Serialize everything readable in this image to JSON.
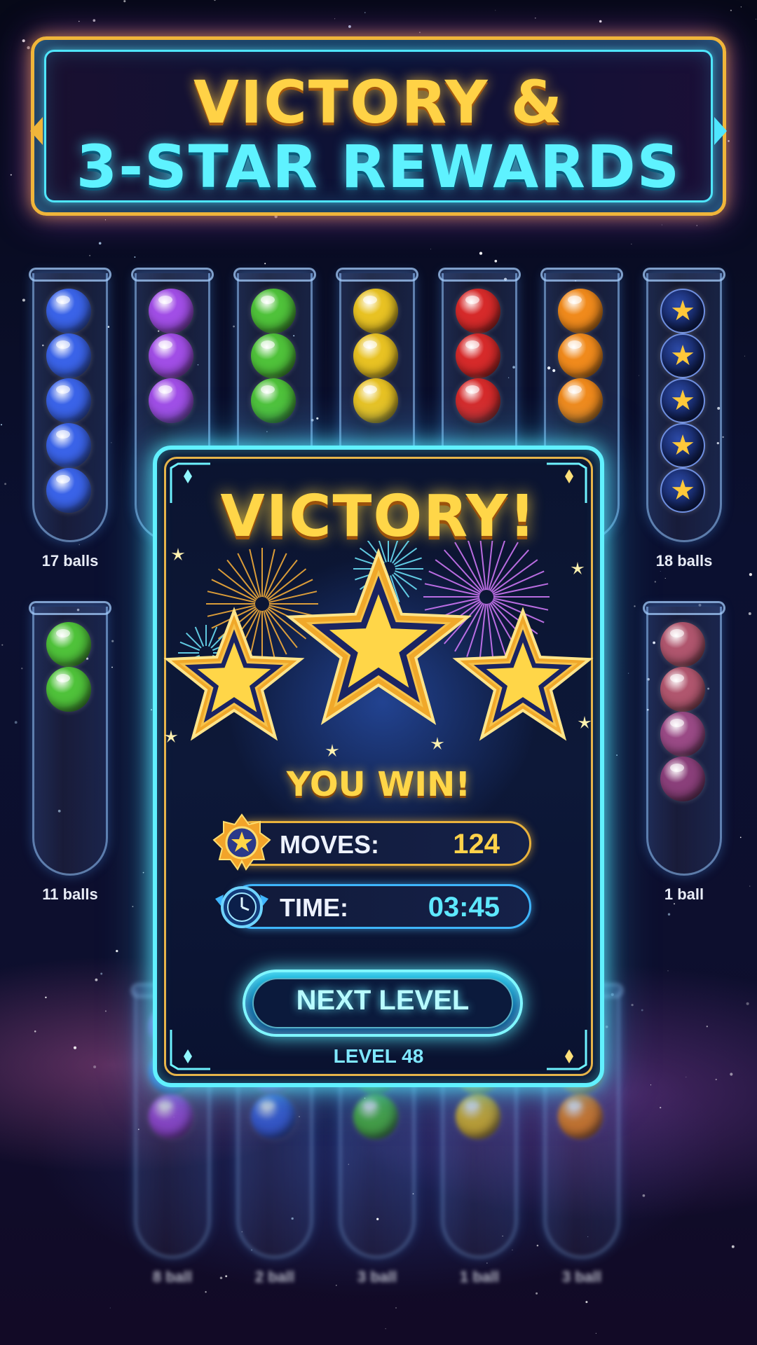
{
  "banner": {
    "line1": "VICTORY &",
    "line2": "3-STAR REWARDS"
  },
  "top_tubes": [
    {
      "label": "17 balls",
      "balls": [
        "#3a63e8",
        "#3a63e8",
        "#3a63e8",
        "#3a63e8",
        "#3a63e8"
      ]
    },
    {
      "label": "",
      "balls": [
        "#a14ee6",
        "#a14ee6",
        "#a14ee6"
      ]
    },
    {
      "label": "",
      "balls": [
        "#4fc23a",
        "#4fc23a",
        "#4fc23a"
      ]
    },
    {
      "label": "",
      "balls": [
        "#e8c223",
        "#e8c223",
        "#e8c223"
      ]
    },
    {
      "label": "",
      "balls": [
        "#d62a2a",
        "#d62a2a",
        "#d62a2a"
      ]
    },
    {
      "label": "",
      "balls": [
        "#f08a1c",
        "#f08a1c",
        "#f08a1c"
      ]
    },
    {
      "label": "18 balls",
      "balls": [
        "star",
        "star",
        "star",
        "star",
        "star"
      ]
    }
  ],
  "mid_tubes": [
    {
      "label": "11 balls",
      "balls": [
        "#4fc23a",
        "#4fc23a"
      ]
    },
    {
      "label": "1 ball",
      "balls": [
        "#b0566e",
        "#b0566e",
        "#9a4a86",
        "#8a3f7a"
      ]
    }
  ],
  "bottom_tubes": [
    {
      "label": "8 ball",
      "balls": [
        "#a14ee6",
        "#3a63e8",
        "#a14ee6"
      ]
    },
    {
      "label": "2 ball",
      "balls": [
        "#3a63e8",
        "#a14ee6",
        "#3a63e8"
      ]
    },
    {
      "label": "3 ball",
      "balls": [
        "#4fc23a",
        "#4fc23a",
        "#4fc23a"
      ]
    },
    {
      "label": "1 ball",
      "balls": [
        "#b0566e",
        "#e8c223",
        "#e8c223"
      ]
    },
    {
      "label": "3 ball",
      "balls": [
        "#f08a1c",
        "#f08a1c",
        "#f08a1c"
      ]
    }
  ],
  "card": {
    "title": "VICTORY!",
    "stars_earned": 3,
    "subtitle": "YOU WIN!",
    "moves_label": "MOVES:",
    "moves_value": "124",
    "time_label": "TIME:",
    "time_value": "03:45",
    "next_button": "NEXT LEVEL",
    "level": "LEVEL 48"
  },
  "colors": {
    "gold": "#ffd648",
    "cyan": "#61f1ff",
    "frame_gold": "#e6b44a"
  }
}
